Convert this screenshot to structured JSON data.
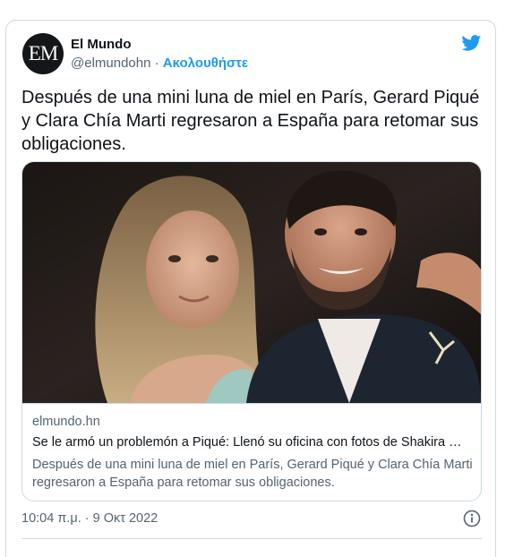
{
  "author": {
    "avatar_text": "EM",
    "name": "El Mundo",
    "handle": "@elmundohn",
    "separator": "·",
    "follow_label": "Ακολουθήστε"
  },
  "tweet": {
    "text": "Después de una mini luna de miel en París, Gerard Piqué y Clara Chía Marti regresaron a España para retomar sus obligaciones.",
    "timestamp": "10:04 π.μ. · 9 Οκτ 2022"
  },
  "link_card": {
    "domain": "elmundo.hn",
    "title": "Se le armó un problemón a Piqué: Llenó su oficina con fotos de Shakira …",
    "description": "Después de una mini luna de miel en París, Gerard Piqué y Clara Chía Marti regresaron a España para retomar sus obligaciones."
  },
  "icons": {
    "logo": "twitter-bird-icon",
    "info": "info-icon"
  },
  "colors": {
    "accent": "#1d9bf0",
    "text": "#0f1419",
    "secondary": "#536471",
    "border": "#cfd9de"
  }
}
